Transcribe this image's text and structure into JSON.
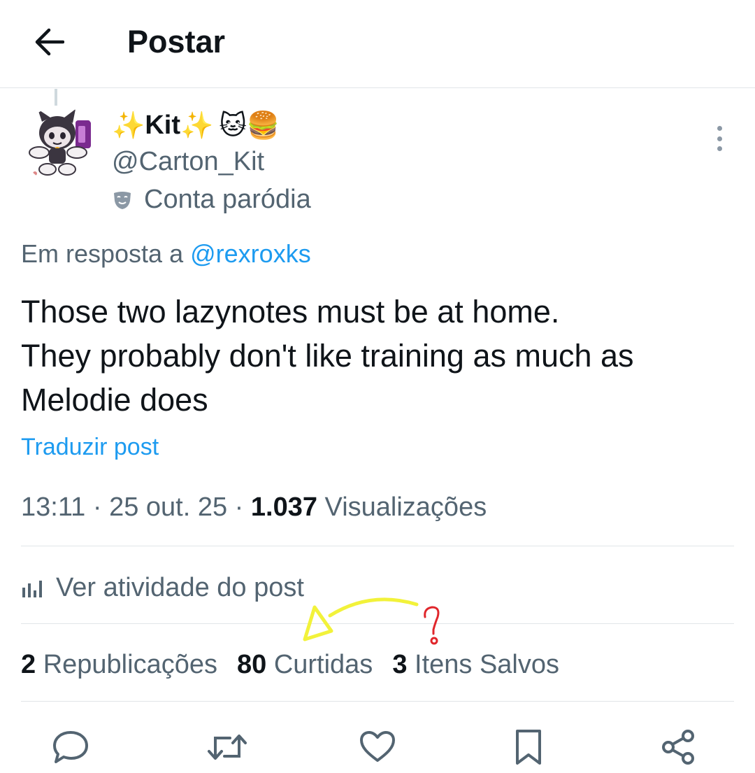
{
  "header": {
    "title": "Postar",
    "back_icon": "arrow-left-icon"
  },
  "author": {
    "name_prefix": "✨",
    "name_main": "Kit",
    "name_suffix": "✨",
    "name_emojis": "🐱🍔",
    "handle": "@Carton_Kit",
    "parody_label": "Conta paródia"
  },
  "post": {
    "reply_prefix": "Em resposta a",
    "reply_handle": "@rexroxks",
    "lines": [
      "Those two lazynotes must be at home.",
      "They probably don't like training as much as",
      "Melodie does"
    ],
    "translate": "Traduzir post",
    "time": "13:11",
    "date": "25 out. 25",
    "views_count": "1.037",
    "views_label": "Visualizações",
    "separator": "·"
  },
  "activity": {
    "label": "Ver atividade do post"
  },
  "stats": {
    "reposts_count": "2",
    "reposts_label": "Republicações",
    "likes_count": "80",
    "likes_label": "Curtidas",
    "saves_count": "3",
    "saves_label": "Itens Salvos"
  },
  "annotation": {
    "question_mark": "?",
    "arrow_color": "#f2f23a",
    "question_color": "#e0262b"
  },
  "colors": {
    "text": "#0f1419",
    "secondary": "#536471",
    "link": "#1d9bf0",
    "divider": "#e1e5e8"
  },
  "actions": [
    "reply-icon",
    "repost-icon",
    "like-icon",
    "bookmark-icon",
    "share-icon"
  ]
}
